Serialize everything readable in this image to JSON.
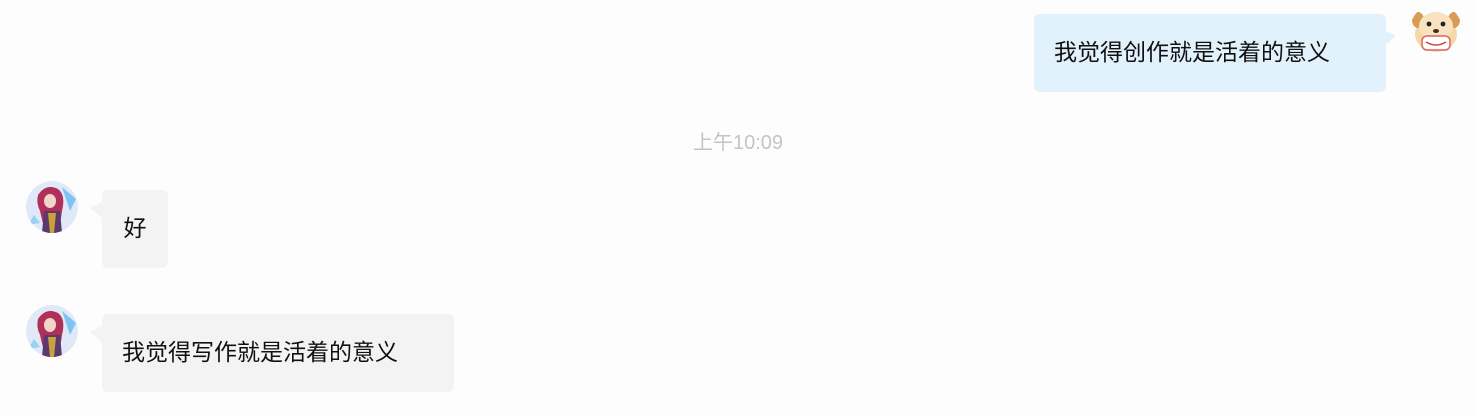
{
  "messages": [
    {
      "direction": "outgoing",
      "text": "我觉得创作就是活着的意义",
      "avatar": "dog-cartoon-avatar"
    },
    {
      "direction": "incoming",
      "text": "好",
      "avatar": "anime-character-avatar"
    },
    {
      "direction": "incoming",
      "text": "我觉得写作就是活着的意义",
      "avatar": "anime-character-avatar"
    }
  ],
  "timestamp": "上午10:09",
  "colors": {
    "outgoing_bubble": "#e2f2fd",
    "incoming_bubble": "#f3f3f3",
    "timestamp_text": "#c4c4c4",
    "background": "#fdfdfd"
  }
}
